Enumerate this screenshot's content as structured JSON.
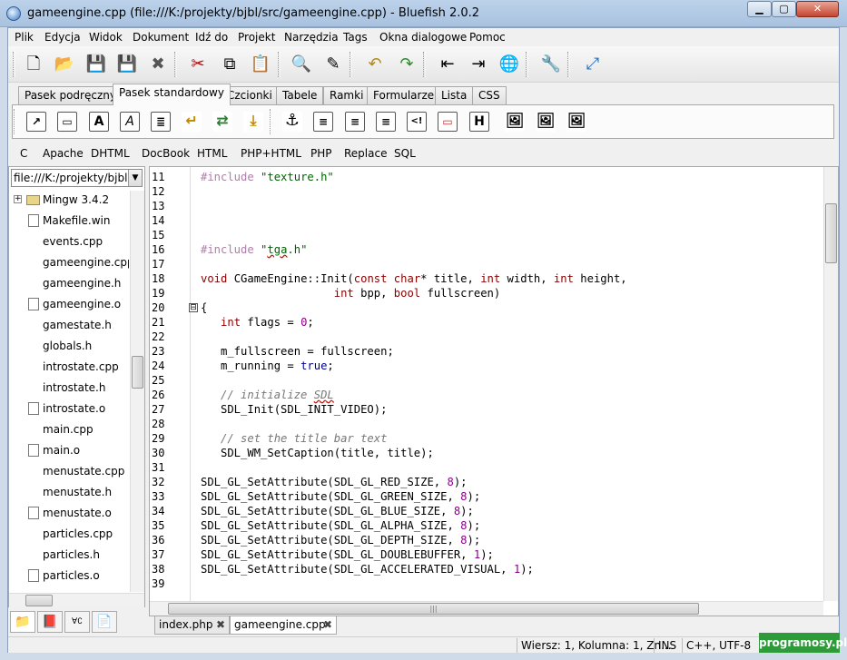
{
  "window": {
    "title": "gameengine.cpp (file:///K:/projekty/bjbl/src/gameengine.cpp) - Bluefish 2.0.2",
    "minimize_label": "▁",
    "maximize_label": "▢",
    "close_label": "✕"
  },
  "menu": {
    "items": [
      "Plik",
      "Edycja",
      "Widok",
      "Dokument",
      "Idź do",
      "Projekt",
      "Narzędzia",
      "Tags",
      "Okna dialogowe",
      "Pomoc"
    ]
  },
  "toolbar_icons": [
    "new-document-icon",
    "open-folder-icon",
    "save-icon",
    "save-as-icon",
    "close-icon",
    "cut-icon",
    "copy-icon",
    "paste-icon",
    "find-icon",
    "replace-icon",
    "undo-icon",
    "redo-icon",
    "shift-left-icon",
    "shift-right-icon",
    "browser-preview-icon",
    "preferences-icon",
    "fullscreen-icon"
  ],
  "toolbar_glyphs": [
    "🗋",
    "📂",
    "💾",
    "💾",
    "✖",
    "✂",
    "⧉",
    "📋",
    "🔍",
    "✎",
    "↶",
    "↷",
    "⇤",
    "⇥",
    "🌐",
    "🔧",
    "⤢"
  ],
  "tabs": [
    "Pasek podręczny",
    "Pasek standardowy",
    "Czcionki",
    "Tabele",
    "Ramki",
    "Formularze",
    "Lista",
    "CSS"
  ],
  "active_tab": "Pasek standardowy",
  "html_toolbar_glyphs": [
    "↗",
    "▭",
    "A",
    "A",
    "≣",
    "↵",
    "⇄",
    "⤓",
    "⚓",
    "≡",
    "≡",
    "≡",
    "<!",
    "▭",
    "H",
    "🖼",
    "🖼",
    "🖼"
  ],
  "dialects": [
    "C",
    "Apache",
    "DHTML",
    "DocBook",
    "HTML",
    "PHP+HTML",
    "PHP",
    "Replace",
    "SQL"
  ],
  "sidebar": {
    "path": "file:///K:/projekty/bjbl",
    "files": [
      {
        "name": "Mingw 3.4.2",
        "type": "folder",
        "expander": "+"
      },
      {
        "name": "Makefile.win",
        "type": "file"
      },
      {
        "name": "events.cpp",
        "type": "none"
      },
      {
        "name": "gameengine.cpp",
        "type": "none"
      },
      {
        "name": "gameengine.h",
        "type": "none"
      },
      {
        "name": "gameengine.o",
        "type": "file"
      },
      {
        "name": "gamestate.h",
        "type": "none"
      },
      {
        "name": "globals.h",
        "type": "none"
      },
      {
        "name": "introstate.cpp",
        "type": "none"
      },
      {
        "name": "introstate.h",
        "type": "none"
      },
      {
        "name": "introstate.o",
        "type": "file"
      },
      {
        "name": "main.cpp",
        "type": "none"
      },
      {
        "name": "main.o",
        "type": "file"
      },
      {
        "name": "menustate.cpp",
        "type": "none"
      },
      {
        "name": "menustate.h",
        "type": "none"
      },
      {
        "name": "menustate.o",
        "type": "file"
      },
      {
        "name": "particles.cpp",
        "type": "none"
      },
      {
        "name": "particles.h",
        "type": "none"
      },
      {
        "name": "particles.o",
        "type": "file"
      }
    ],
    "tab_glyphs": [
      "📁",
      "📕",
      "∀∁",
      "📄"
    ]
  },
  "editor": {
    "line_numbers": [
      "11",
      "12",
      "13",
      "14",
      "15",
      "16",
      "17",
      "18",
      "19",
      "20",
      "21",
      "22",
      "23",
      "24",
      "25",
      "26",
      "27",
      "28",
      "29",
      "30",
      "31",
      "32",
      "33",
      "34",
      "35",
      "36",
      "37",
      "38",
      "39"
    ],
    "fold_marks": [
      "⊟"
    ],
    "lines": [
      [
        {
          "t": "#include ",
          "c": "k-pre"
        },
        {
          "t": "\"texture.h\"",
          "c": "k-str"
        }
      ],
      [],
      [],
      [],
      [],
      [
        {
          "t": "#include ",
          "c": "k-pre"
        },
        {
          "t": "\"",
          "c": "k-str"
        },
        {
          "t": "tga",
          "c": "k-str squig"
        },
        {
          "t": ".h\"",
          "c": "k-str"
        }
      ],
      [],
      [
        {
          "t": "void",
          "c": "k-kw"
        },
        {
          "t": " CGameEngine::Init(",
          "c": ""
        },
        {
          "t": "const char",
          "c": "k-kw"
        },
        {
          "t": "* title, ",
          "c": ""
        },
        {
          "t": "int",
          "c": "k-kw"
        },
        {
          "t": " width, ",
          "c": ""
        },
        {
          "t": "int",
          "c": "k-kw"
        },
        {
          "t": " height,",
          "c": ""
        }
      ],
      [
        {
          "t": "                    ",
          "c": ""
        },
        {
          "t": "int",
          "c": "k-kw"
        },
        {
          "t": " bpp, ",
          "c": ""
        },
        {
          "t": "bool",
          "c": "k-kw"
        },
        {
          "t": " fullscreen)",
          "c": ""
        }
      ],
      [
        {
          "t": "{",
          "c": ""
        }
      ],
      [
        {
          "t": "   ",
          "c": ""
        },
        {
          "t": "int",
          "c": "k-kw"
        },
        {
          "t": " flags = ",
          "c": ""
        },
        {
          "t": "0",
          "c": "k-num"
        },
        {
          "t": ";",
          "c": ""
        }
      ],
      [],
      [
        {
          "t": "   m_fullscreen = fullscreen;",
          "c": ""
        }
      ],
      [
        {
          "t": "   m_running = ",
          "c": ""
        },
        {
          "t": "true",
          "c": "k-true"
        },
        {
          "t": ";",
          "c": ""
        }
      ],
      [],
      [
        {
          "t": "   // initialize ",
          "c": "k-cmt"
        },
        {
          "t": "SDL",
          "c": "k-cmt squig"
        }
      ],
      [
        {
          "t": "   SDL_Init(SDL_INIT_VIDEO);",
          "c": ""
        }
      ],
      [],
      [
        {
          "t": "   // set the title bar text",
          "c": "k-cmt"
        }
      ],
      [
        {
          "t": "   SDL_WM_SetCaption(title, title);",
          "c": ""
        }
      ],
      [],
      [
        {
          "t": "SDL_GL_SetAttribute(SDL_GL_RED_SIZE, ",
          "c": ""
        },
        {
          "t": "8",
          "c": "k-num"
        },
        {
          "t": ");",
          "c": ""
        }
      ],
      [
        {
          "t": "SDL_GL_SetAttribute(SDL_GL_GREEN_SIZE, ",
          "c": ""
        },
        {
          "t": "8",
          "c": "k-num"
        },
        {
          "t": ");",
          "c": ""
        }
      ],
      [
        {
          "t": "SDL_GL_SetAttribute(SDL_GL_BLUE_SIZE, ",
          "c": ""
        },
        {
          "t": "8",
          "c": "k-num"
        },
        {
          "t": ");",
          "c": ""
        }
      ],
      [
        {
          "t": "SDL_GL_SetAttribute(SDL_GL_ALPHA_SIZE, ",
          "c": ""
        },
        {
          "t": "8",
          "c": "k-num"
        },
        {
          "t": ");",
          "c": ""
        }
      ],
      [
        {
          "t": "SDL_GL_SetAttribute(SDL_GL_DEPTH_SIZE, ",
          "c": ""
        },
        {
          "t": "8",
          "c": "k-num"
        },
        {
          "t": ");",
          "c": ""
        }
      ],
      [
        {
          "t": "SDL_GL_SetAttribute(SDL_GL_DOUBLEBUFFER, ",
          "c": ""
        },
        {
          "t": "1",
          "c": "k-num"
        },
        {
          "t": ");",
          "c": ""
        }
      ],
      [
        {
          "t": "SDL_GL_SetAttribute(SDL_GL_ACCELERATED_VISUAL, ",
          "c": ""
        },
        {
          "t": "1",
          "c": "k-num"
        },
        {
          "t": ");",
          "c": ""
        }
      ],
      []
    ]
  },
  "doc_tabs": [
    {
      "label": "index.php",
      "close": "✖"
    },
    {
      "label": "gameengine.cpp",
      "close": "✖"
    }
  ],
  "status": {
    "position": "Wiersz: 1, Kolumna: 1, Zn...",
    "mode": "INS",
    "encoding": "C++, UTF-8"
  },
  "watermark": "programosy.pl",
  "colors": {
    "preprocessor": "#ad7fa8",
    "string": "#006400",
    "keyword": "#8b0000",
    "number": "#8b008b",
    "comment": "#777777",
    "boolean": "#00008b"
  }
}
